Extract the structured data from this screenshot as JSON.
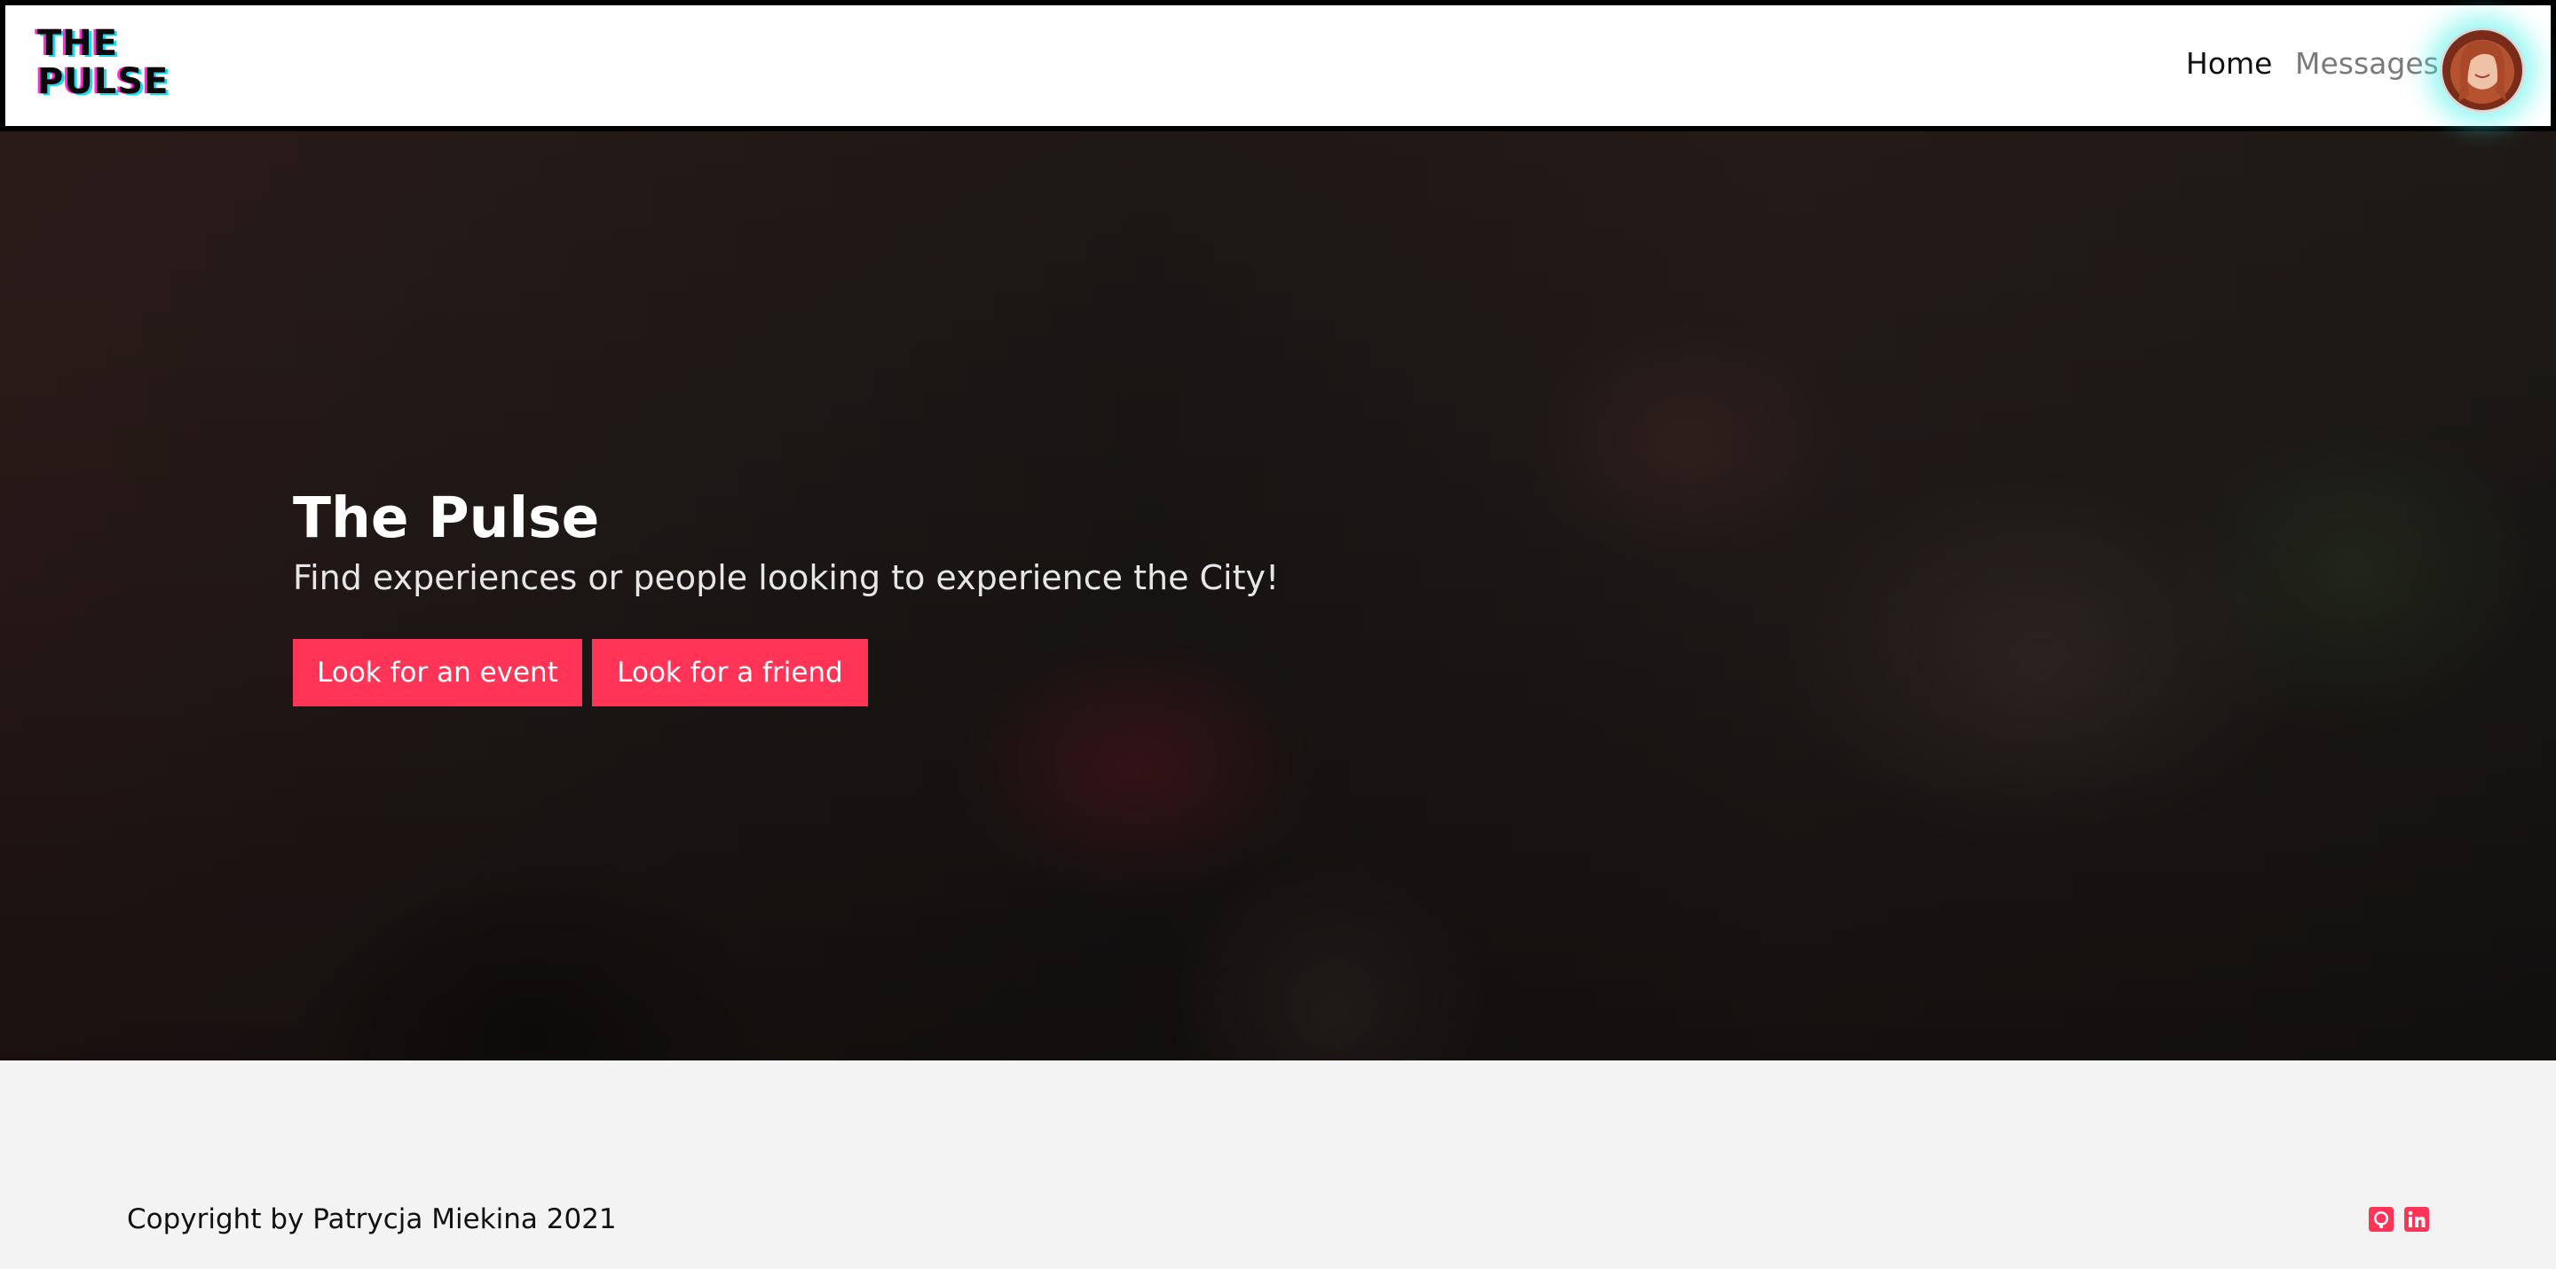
{
  "header": {
    "logo_line1": "THE",
    "logo_line2": "PULSE",
    "nav": {
      "home": "Home",
      "messages": "Messages"
    }
  },
  "hero": {
    "title": "The Pulse",
    "subtitle": "Find experiences or people looking to experience the City!",
    "buttons": {
      "event": "Look for an event",
      "friend": "Look for a friend"
    }
  },
  "footer": {
    "copyright": "Copyright by Patrycja Miekina 2021",
    "social": [
      {
        "icon": "github-icon"
      },
      {
        "icon": "linkedin-icon"
      }
    ]
  },
  "colors": {
    "accent": "#ff3456",
    "avatar_glow": "#46f0e8",
    "logo_magenta": "#ff2bd6",
    "logo_cyan": "#19d8f0"
  }
}
